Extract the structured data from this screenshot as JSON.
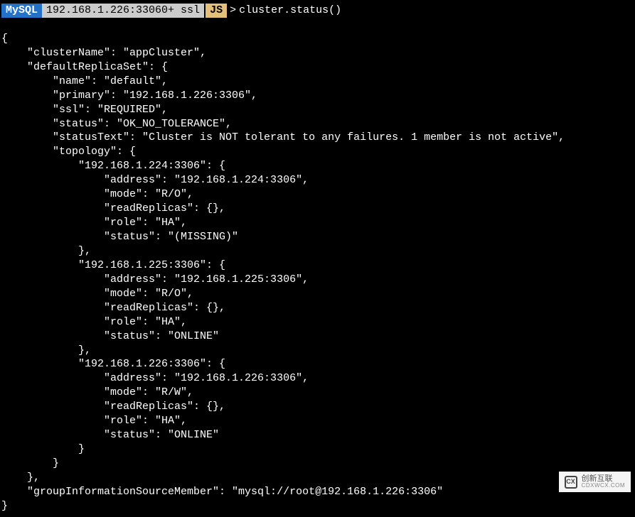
{
  "prompt": {
    "badge_mysql": "MySQL",
    "host": "192.168.1.226:33060+ ssl",
    "badge_js": "JS",
    "arrow": ">",
    "command": "cluster.status()"
  },
  "output": {
    "open_brace": "{",
    "cluster_name_key": "    \"clusterName\": ",
    "cluster_name_val": "\"appCluster\"",
    "default_replica_key": "    \"defaultReplicaSet\": {",
    "name_line": "        \"name\": \"default\",",
    "primary_line": "        \"primary\": \"192.168.1.226:3306\",",
    "ssl_line": "        \"ssl\": \"REQUIRED\",",
    "status_line": "        \"status\": \"OK_NO_TOLERANCE\",",
    "status_text_line": "        \"statusText\": \"Cluster is NOT tolerant to any failures. 1 member is not active\",",
    "topology_open": "        \"topology\": {",
    "node1_key": "            \"192.168.1.224:3306\": {",
    "node1_address": "                \"address\": \"192.168.1.224:3306\",",
    "node1_mode": "                \"mode\": \"R/O\",",
    "node1_replicas": "                \"readReplicas\": {},",
    "node1_role": "                \"role\": \"HA\",",
    "node1_status": "                \"status\": \"(MISSING)\"",
    "node1_close": "            },",
    "node2_key": "            \"192.168.1.225:3306\": {",
    "node2_address": "                \"address\": \"192.168.1.225:3306\",",
    "node2_mode": "                \"mode\": \"R/O\",",
    "node2_replicas": "                \"readReplicas\": {},",
    "node2_role": "                \"role\": \"HA\",",
    "node2_status": "                \"status\": \"ONLINE\"",
    "node2_close": "            },",
    "node3_key": "            \"192.168.1.226:3306\": {",
    "node3_address": "                \"address\": \"192.168.1.226:3306\",",
    "node3_mode": "                \"mode\": \"R/W\",",
    "node3_replicas": "                \"readReplicas\": {},",
    "node3_role": "                \"role\": \"HA\",",
    "node3_status": "                \"status\": \"ONLINE\"",
    "node3_close": "            }",
    "topology_close": "        }",
    "default_replica_close": "    },",
    "group_info_line": "    \"groupInformationSourceMember\": \"mysql://root@192.168.1.226:3306\"",
    "close_brace": "}"
  },
  "watermark": {
    "logo_text": "CX",
    "main": "创新互联",
    "sub": "CDXWCX.COM"
  }
}
